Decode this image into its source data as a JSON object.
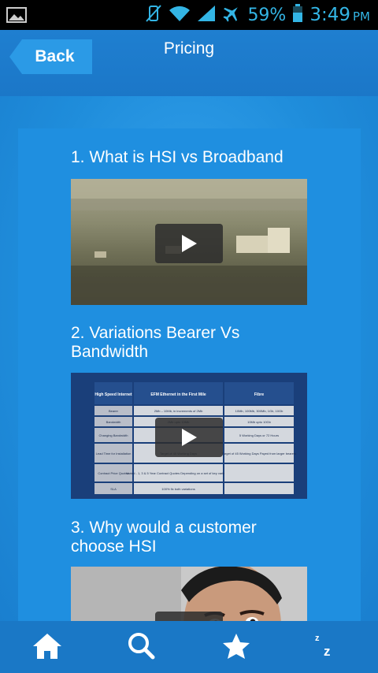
{
  "status_bar": {
    "battery": "59%",
    "time": "3:49",
    "ampm": "PM",
    "icons": [
      "image-icon",
      "vibrate-off-icon",
      "wifi-icon",
      "signal-icon",
      "airplane-icon",
      "battery-icon"
    ]
  },
  "header": {
    "back_label": "Back",
    "title": "Pricing"
  },
  "videos": [
    {
      "title": "1. What is HSI vs Broadband",
      "thumbnail": "aerial-city-landscape"
    },
    {
      "title": "2. Variations Bearer Vs Bandwidth",
      "thumbnail": "comparison-table-slide"
    },
    {
      "title": "3. Why would a customer choose HSI",
      "thumbnail": "presenter-face"
    }
  ],
  "thumbnail_table": {
    "headers": [
      "High Speed Internet",
      "EFM Ethernet in the First Mile",
      "Fibre"
    ],
    "rows": [
      [
        "Bearer",
        "2Mb – 10Mb, in increments of 2Mb",
        "10Mb, 100Mb, 300Mb, 1Gb, 10Gb"
      ],
      [
        "Bandwidth",
        "2Mb upto 10Mb",
        "10Mb upto 10Gb"
      ],
      [
        "Changing Bandwidth",
        "",
        "5 Working Days or 72 Hours"
      ],
      [
        "Lead Time for Installation",
        "Target of 40 Working Days",
        "Target of 45 Working Days Payed from larger bearers"
      ],
      [
        "Contract Price Quotes",
        "Varied - 1, 3 & 5 Year Contract Quotes Depending on a set of key variables",
        ""
      ],
      [
        "SLA",
        "100% fix both variations",
        ""
      ]
    ]
  },
  "bottom_nav": [
    {
      "name": "home",
      "icon": "home-icon"
    },
    {
      "name": "search",
      "icon": "search-icon"
    },
    {
      "name": "favorites",
      "icon": "star-icon"
    },
    {
      "name": "sleep",
      "icon": "sleep-icon",
      "label": "z"
    }
  ],
  "colors": {
    "header": "#1b77c8",
    "content": "#1f8fe0",
    "nav": "#1a78c6",
    "status_text": "#33b5e5",
    "back_button": "#2b9ae6"
  }
}
